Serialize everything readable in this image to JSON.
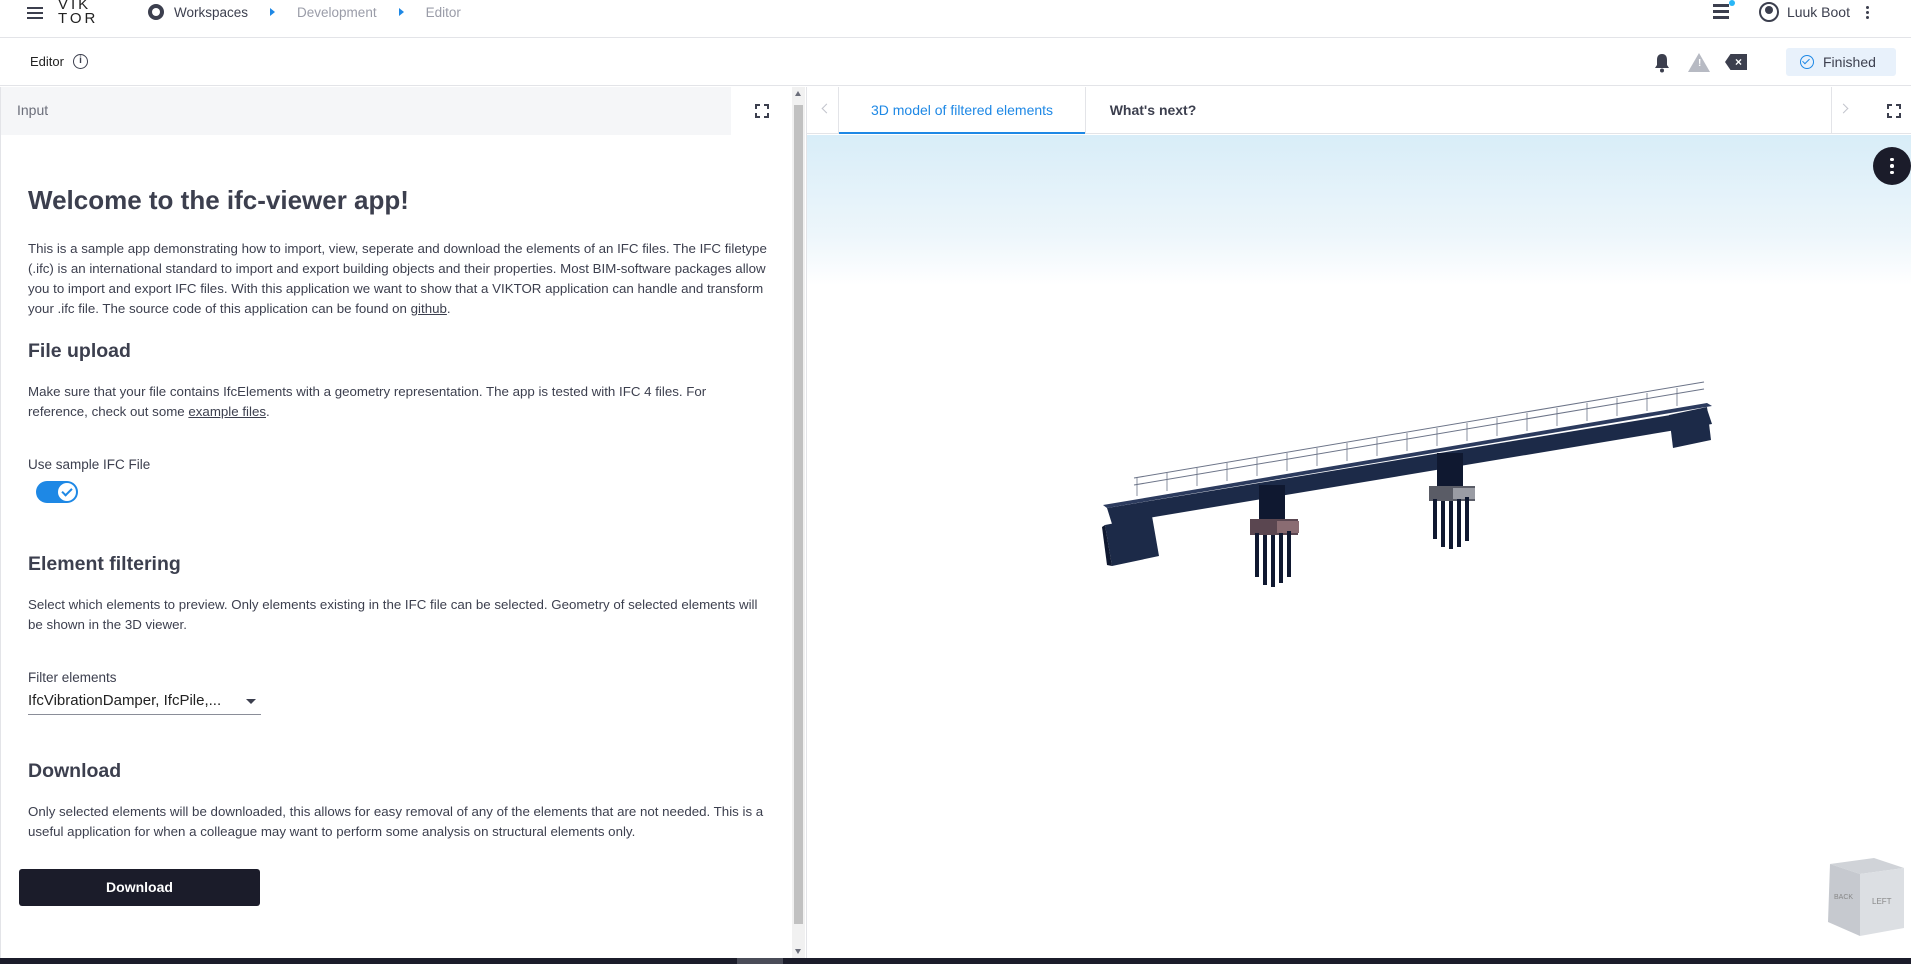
{
  "topbar": {
    "logo": "VIK TOR",
    "breadcrumb": [
      "Workspaces",
      "Development",
      "Editor"
    ],
    "username": "Luuk Boot"
  },
  "editorbar": {
    "title": "Editor",
    "info_glyph": "i",
    "status": "Finished"
  },
  "left": {
    "header": "Input",
    "welcome_title": "Welcome to the ifc-viewer app!",
    "intro_text": "This is a sample app demonstrating how to import, view, seperate and download the elements of an IFC files. The IFC filetype (.ifc) is an international standard to import and export building objects and their properties. Most BIM-software packages allow you to import and export IFC files. With this application we want to show that a VIKTOR application can handle and transform your .ifc file. The source code of this application can be found on",
    "intro_link": "github",
    "file_upload_title": "File upload",
    "file_upload_text": "Make sure that your file contains IfcElements with a geometry representation. The app is tested with IFC 4 files. For reference, check out some",
    "file_upload_link": "example files",
    "sample_toggle_label": "Use sample IFC File",
    "sample_toggle_on": true,
    "filtering_title": "Element filtering",
    "filtering_text": "Select which elements to preview. Only elements existing in the IFC file can be selected. Geometry of selected elements will be shown in the 3D viewer.",
    "filter_label": "Filter elements",
    "filter_value": "IfcVibrationDamper, IfcPile,...",
    "download_title": "Download",
    "download_text": "Only selected elements will be downloaded, this allows for easy removal of any of the elements that are not needed. This is a useful application for when a colleague may want to perform some analysis on structural elements only.",
    "download_button": "Download"
  },
  "right": {
    "tabs": [
      "3D model of filtered elements",
      "What's next?"
    ],
    "active_tab": 0,
    "cube_faces": [
      "BACK",
      "LEFT"
    ]
  },
  "colors": {
    "accent": "#1e88e5",
    "dark": "#1b1c2a",
    "text": "#3c3f4e",
    "bridge": "#1c2a48"
  },
  "icons": [
    "menu-icon",
    "workspace-icon",
    "stack-icon",
    "user-icon",
    "kebab-icon",
    "info-icon",
    "bell-icon",
    "warning-icon",
    "clear-icon",
    "check-circle-icon",
    "expand-icon",
    "chevron-left-icon",
    "chevron-right-icon",
    "dropdown-caret-icon"
  ]
}
